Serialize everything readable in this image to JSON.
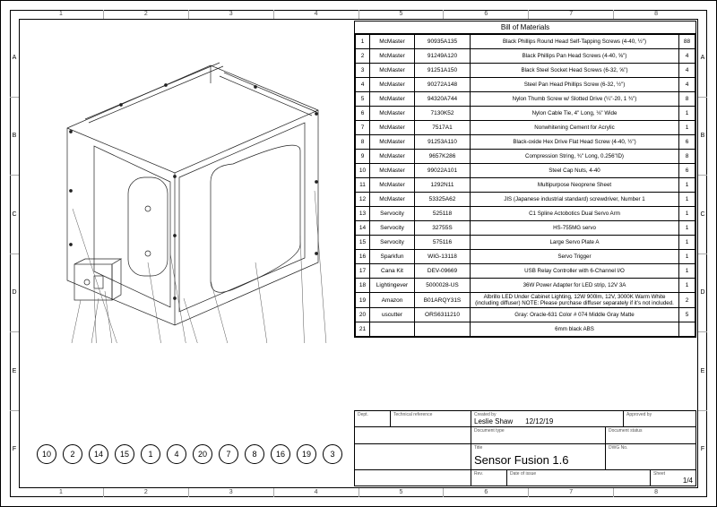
{
  "ruler": {
    "cols": [
      "1",
      "2",
      "3",
      "4",
      "5",
      "6",
      "7",
      "8"
    ],
    "rows": [
      "A",
      "B",
      "C",
      "D",
      "E",
      "F"
    ]
  },
  "bom": {
    "title": "Bill of Materials",
    "rows": [
      {
        "n": "1",
        "v": "McMaster",
        "p": "90935A135",
        "d": "Black Phillips Round Head Self-Tapping Screws (4-40, ½\")",
        "q": "88"
      },
      {
        "n": "2",
        "v": "McMaster",
        "p": "91249A120",
        "d": "Black Phillips Pan Head Screws (4-40, ⅝\")",
        "q": "4"
      },
      {
        "n": "3",
        "v": "McMaster",
        "p": "91251A150",
        "d": "Black Steel Socket Head Screws (6-32, ⅝\")",
        "q": "4"
      },
      {
        "n": "4",
        "v": "McMaster",
        "p": "90272A148",
        "d": "Steel Pan Head Phillips Screw (6-32, ½\")",
        "q": "4"
      },
      {
        "n": "5",
        "v": "McMaster",
        "p": "94320A744",
        "d": "Nylon Thumb Screw w/ Slotted Drive (¼\"-20, 1 ¾\")",
        "q": "8"
      },
      {
        "n": "6",
        "v": "McMaster",
        "p": "7130K52",
        "d": "Nylon Cable Tie, 4\" Long, ⅛\" Wide",
        "q": "1"
      },
      {
        "n": "7",
        "v": "McMaster",
        "p": "7517A1",
        "d": "Nonwhitening Cement for Acrylic",
        "q": "1"
      },
      {
        "n": "8",
        "v": "McMaster",
        "p": "91253A110",
        "d": "Black-oxide Hex Drive Flat Head Screw (4-40, ½\")",
        "q": "6"
      },
      {
        "n": "9",
        "v": "McMaster",
        "p": "9657K286",
        "d": "Compression String, ¾\" Long, 0.256\"ID)",
        "q": "8"
      },
      {
        "n": "10",
        "v": "McMaster",
        "p": "99022A101",
        "d": "Steel Cap Nuts, 4-40",
        "q": "6"
      },
      {
        "n": "11",
        "v": "McMaster",
        "p": "1292N11",
        "d": "Multipurpose Neoprene Sheet",
        "q": "1"
      },
      {
        "n": "12",
        "v": "McMaster",
        "p": "53325A62",
        "d": "JIS (Japanese industrial standard) screwdriver, Number 1",
        "q": "1"
      },
      {
        "n": "13",
        "v": "Servocity",
        "p": "525118",
        "d": "C1 Spline Actobotics Dual Servo Arm",
        "q": "1"
      },
      {
        "n": "14",
        "v": "Servocity",
        "p": "32755S",
        "d": "HS-755MG servo",
        "q": "1"
      },
      {
        "n": "15",
        "v": "Servocity",
        "p": "575116",
        "d": "Large Servo Plate A",
        "q": "1"
      },
      {
        "n": "16",
        "v": "Sparkfun",
        "p": "WIG-13118",
        "d": "Servo Trigger",
        "q": "1"
      },
      {
        "n": "17",
        "v": "Cana Kit",
        "p": "DEV-09669",
        "d": "USB Relay Controller with 6-Channel I/O",
        "q": "1"
      },
      {
        "n": "18",
        "v": "Lightingever",
        "p": "5000028-US",
        "d": "36W Power Adapter for LED strip, 12V 3A",
        "q": "1"
      },
      {
        "n": "19",
        "v": "Amazon",
        "p": "B01ARQY31S",
        "d": "Albrillo LED Under Cabinet Lighting, 12W 900lm, 12V, 3000K Warm White (including diffuser) NOTE: Please purchase diffuser separately if it's not included.",
        "q": "2"
      },
      {
        "n": "20",
        "v": "uscutter",
        "p": "ORS6311210",
        "d": "Gray: Oracle-631 Color # 074 Middle Gray Matte",
        "q": "5"
      },
      {
        "n": "21",
        "v": "",
        "p": "",
        "d": "6mm black ABS",
        "q": ""
      }
    ]
  },
  "titleblock": {
    "dept": "Dept.",
    "techref": "Technical reference",
    "created": "Created by",
    "approved": "Approved by",
    "creator": "Leslie Shaw",
    "date": "12/12/19",
    "doctype": "Document type",
    "docstatus": "Document status",
    "titleLabel": "Title",
    "title": "Sensor Fusion 1.6",
    "dwg": "DWG No.",
    "rev": "Rev.",
    "doi": "Date of issue",
    "sheet": "Sheet",
    "sheetVal": "1/4"
  },
  "callouts": [
    "10",
    "2",
    "14",
    "15",
    "1",
    "4",
    "20",
    "7",
    "8",
    "16",
    "19",
    "3"
  ]
}
